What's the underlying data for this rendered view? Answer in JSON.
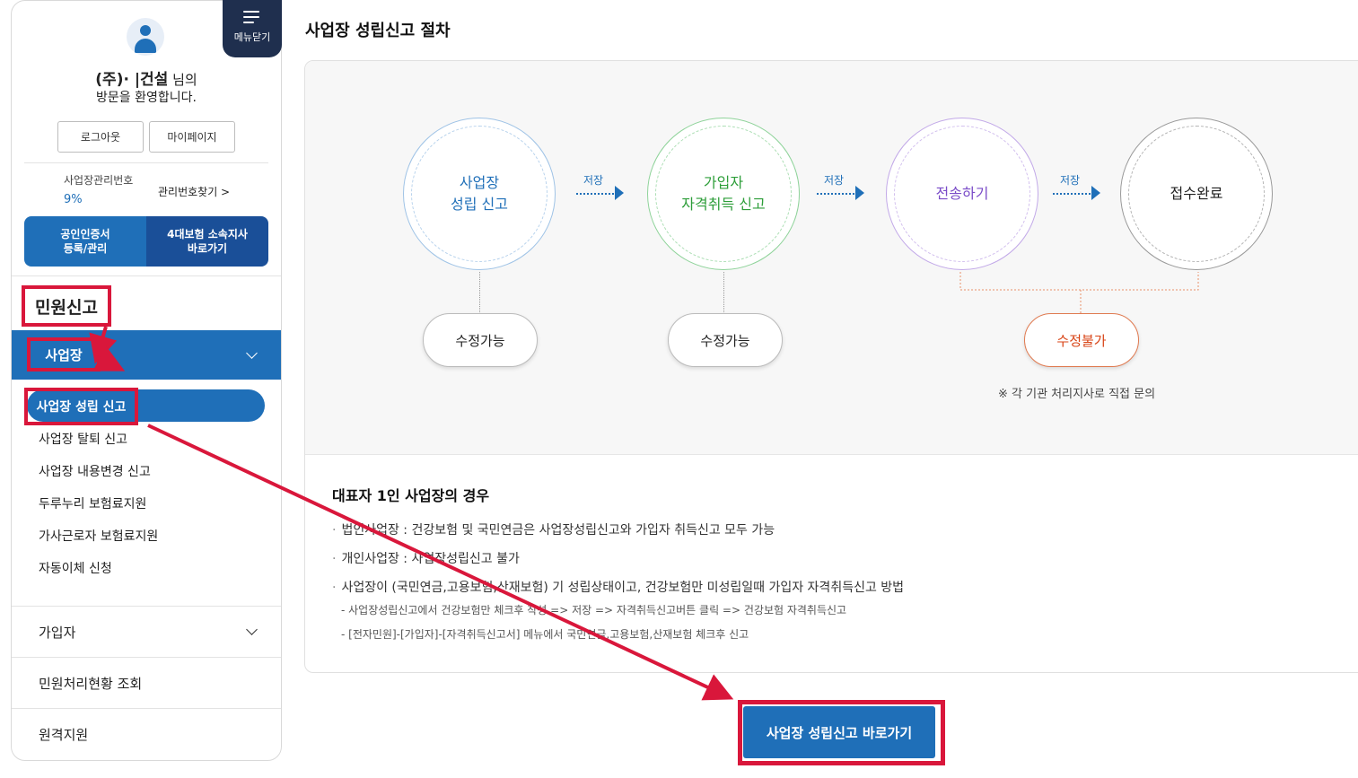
{
  "sidebar": {
    "menu_close_label": "메뉴닫기",
    "welcome_name": "(주)·          |건설",
    "welcome_suffix": "님의",
    "welcome_msg": "방문을 환영합니다.",
    "logout_label": "로그아웃",
    "mypage_label": "마이페이지",
    "mgmt_label": "사업장관리번호",
    "mgmt_value": "9%",
    "mgmt_find_label": "관리번호찾기 >",
    "quick_cert_label": "공인인증서\n등록/관리",
    "quick_branch_label": "4대보험 소속지사\n바로가기",
    "section_title": "민원신고",
    "nav_business": "사업장",
    "sub_items": [
      "사업장 성립 신고",
      "사업장 탈퇴 신고",
      "사업장 내용변경 신고",
      "두루누리 보험료지원",
      "가사근로자 보험료지원",
      "자동이체 신청"
    ],
    "nav_member": "가입자",
    "nav_status": "민원처리현황 조회",
    "nav_remote": "원격지원"
  },
  "main": {
    "page_title": "사업장 성립신고 절차",
    "steps": [
      {
        "label": "사업장\n성립 신고",
        "color": "#1f6fb8"
      },
      {
        "label": "가입자\n자격취득 신고",
        "color": "#2e9e3a"
      },
      {
        "label": "전송하기",
        "color": "#7a4cc8"
      },
      {
        "label": "접수완료",
        "color": "#222222"
      }
    ],
    "save_label": "저장",
    "editable_label": "수정가능",
    "not_editable_label": "수정불가",
    "notice": "※ 각 기관 처리지사로 직접 문의",
    "sec_title": "대표자 1인 사업장의 경우",
    "bullets": [
      "법인사업장 : 건강보험 및 국민연금은 사업장성립신고와 가입자 취득신고 모두 가능",
      "개인사업장 : 사업장성립신고 불가",
      "사업장이 (국민연금,고용보험,산재보험) 기 성립상태이고, 건강보험만 미성립일때 가입자 자격취득신고 방법"
    ],
    "sublines": [
      "- 사업장성립신고에서 건강보험만 체크후 작성 => 저장 => 자격취득신고버튼 클릭 => 건강보험 자격취득신고",
      "- [전자민원]-[가입자]-[자격취득신고서] 메뉴에서 국민연금,고용보험,산재보험 체크후 신고"
    ],
    "go_button_label": "사업장 성립신고 바로가기"
  },
  "colors": {
    "primary": "#1f6fb8",
    "navy": "#1f2f4e",
    "highlight": "#d9173b"
  }
}
